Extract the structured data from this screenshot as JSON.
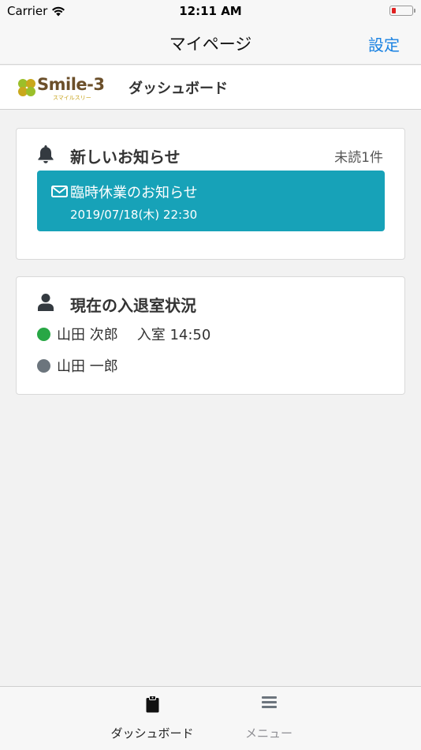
{
  "status_bar": {
    "carrier": "Carrier",
    "time": "12:11 AM"
  },
  "nav": {
    "title": "マイページ",
    "settings": "設定"
  },
  "header": {
    "logo_text": "Smile-3",
    "logo_sub": "スマイルスリー",
    "title": "ダッシュボード"
  },
  "notices": {
    "title": "新しいお知らせ",
    "unread": "未読1件",
    "items": [
      {
        "title": "臨時休業のお知らせ",
        "date": "2019/07/18(木) 22:30"
      }
    ]
  },
  "attendance": {
    "title": "現在の入退室状況",
    "people": [
      {
        "name": "山田 次郎",
        "status": "in",
        "entry": "入室 14:50"
      },
      {
        "name": "山田 一郎",
        "status": "out",
        "entry": ""
      }
    ]
  },
  "tabs": [
    {
      "label": "ダッシュボード",
      "icon": "clipboard-icon",
      "active": true
    },
    {
      "label": "メニュー",
      "icon": "menu-icon",
      "active": false
    }
  ],
  "colors": {
    "accent": "#1a82e2",
    "notice_bg": "#17a2b8",
    "in": "#28a745",
    "out": "#6c757d"
  }
}
